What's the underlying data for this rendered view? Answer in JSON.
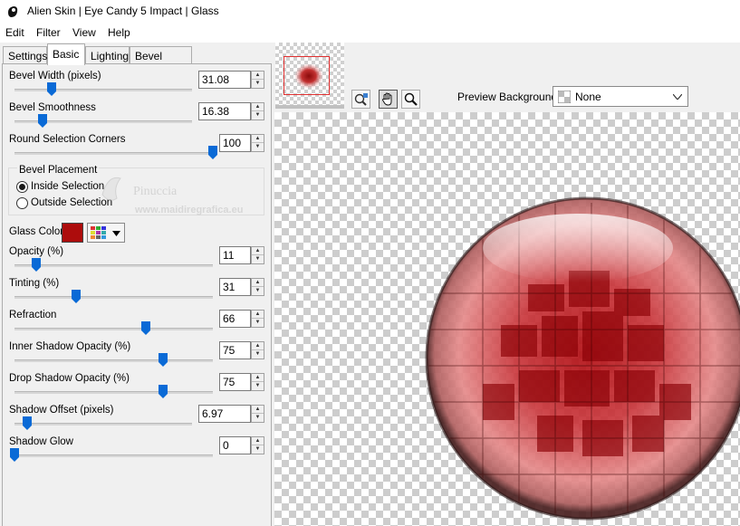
{
  "window": {
    "title": "Alien Skin | Eye Candy 5 Impact | Glass"
  },
  "menu": [
    "Edit",
    "Filter",
    "View",
    "Help"
  ],
  "tabs": [
    "Settings",
    "Basic",
    "Lighting",
    "Bevel Profile"
  ],
  "active_tab": "Basic",
  "controls": {
    "bevel_width": {
      "label": "Bevel Width (pixels)",
      "value": "31.08",
      "level": 0.21
    },
    "bevel_smoothness": {
      "label": "Bevel Smoothness",
      "value": "16.38",
      "level": 0.16
    },
    "round_corners": {
      "label": "Round Selection Corners",
      "value": "100",
      "level": 1.0
    },
    "bevel_placement": {
      "label": "Bevel Placement",
      "inside": "Inside Selection",
      "outside": "Outside Selection",
      "selected": "inside"
    },
    "glass_color": {
      "label": "Glass Color",
      "color": "#ad0c0c"
    },
    "opacity": {
      "label": "Opacity (%)",
      "value": "11",
      "level": 0.11
    },
    "tinting": {
      "label": "Tinting (%)",
      "value": "31",
      "level": 0.31
    },
    "refraction": {
      "label": "Refraction",
      "value": "66",
      "level": 0.66
    },
    "inner_shadow": {
      "label": "Inner Shadow Opacity (%)",
      "value": "75",
      "level": 0.75
    },
    "drop_shadow": {
      "label": "Drop Shadow Opacity (%)",
      "value": "75",
      "level": 0.75
    },
    "shadow_offset": {
      "label": "Shadow Offset (pixels)",
      "value": "6.97",
      "level": 0.07
    },
    "shadow_glow": {
      "label": "Shadow Glow",
      "value": "0",
      "level": 0.0
    }
  },
  "preview": {
    "background_label": "Preview Background:",
    "background_value": "None"
  },
  "watermark": {
    "name": "Pinuccia",
    "url": "www.maidiregrafica.eu"
  },
  "icons": [
    "app-icon",
    "navigator-tool-icon",
    "hand-tool-icon",
    "zoom-tool-icon",
    "palette-icon",
    "dropdown-arrow-icon"
  ]
}
